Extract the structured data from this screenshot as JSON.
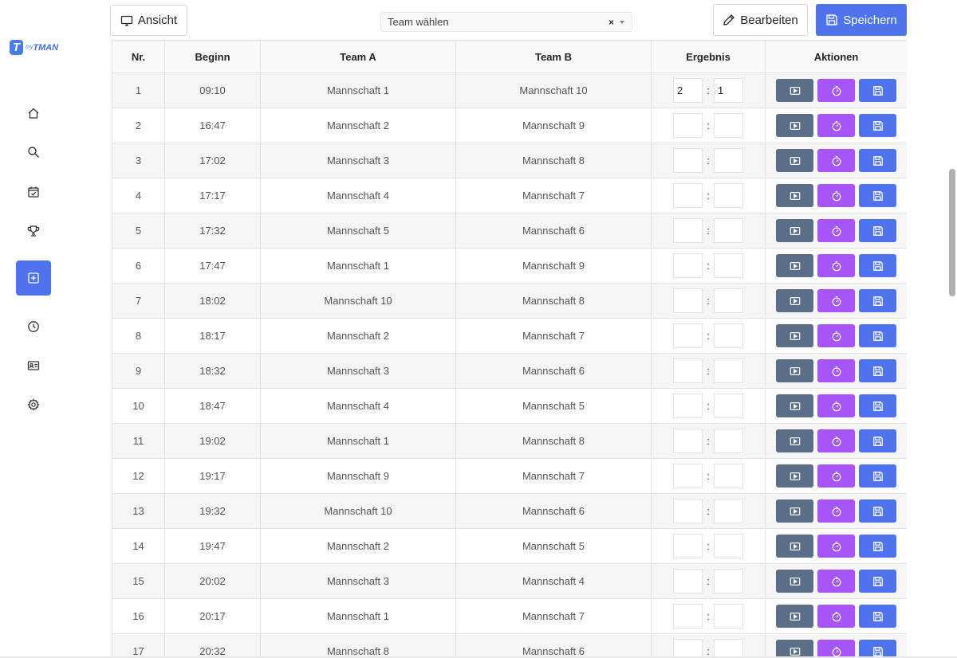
{
  "app": {
    "logo_mark": "T",
    "logo_prefix": "my",
    "logo_name": "TMAN"
  },
  "sidebar": {
    "items": [
      {
        "icon": "home-icon",
        "active": false
      },
      {
        "icon": "search-icon",
        "active": false
      },
      {
        "icon": "calendar-check-icon",
        "active": false
      },
      {
        "icon": "trophy-icon",
        "active": false
      },
      {
        "icon": "plus-square-icon",
        "active": true
      },
      {
        "icon": "clock-icon",
        "active": false
      },
      {
        "icon": "id-card-icon",
        "active": false
      },
      {
        "icon": "gear-icon",
        "active": false
      }
    ]
  },
  "toolbar": {
    "view_label": "Ansicht",
    "team_select_placeholder": "Team wählen",
    "edit_label": "Bearbeiten",
    "save_label": "Speichern"
  },
  "table": {
    "headers": [
      "Nr.",
      "Beginn",
      "Team A",
      "Team B",
      "Ergebnis",
      "Aktionen"
    ],
    "rows": [
      {
        "nr": "1",
        "time": "09:10",
        "team_a": "Mannschaft 1",
        "team_b": "Mannschaft 10",
        "score_a": "2",
        "score_b": "1"
      },
      {
        "nr": "2",
        "time": "16:47",
        "team_a": "Mannschaft 2",
        "team_b": "Mannschaft 9",
        "score_a": "",
        "score_b": ""
      },
      {
        "nr": "3",
        "time": "17:02",
        "team_a": "Mannschaft 3",
        "team_b": "Mannschaft 8",
        "score_a": "",
        "score_b": ""
      },
      {
        "nr": "4",
        "time": "17:17",
        "team_a": "Mannschaft 4",
        "team_b": "Mannschaft 7",
        "score_a": "",
        "score_b": ""
      },
      {
        "nr": "5",
        "time": "17:32",
        "team_a": "Mannschaft 5",
        "team_b": "Mannschaft 6",
        "score_a": "",
        "score_b": ""
      },
      {
        "nr": "6",
        "time": "17:47",
        "team_a": "Mannschaft 1",
        "team_b": "Mannschaft 9",
        "score_a": "",
        "score_b": ""
      },
      {
        "nr": "7",
        "time": "18:02",
        "team_a": "Mannschaft 10",
        "team_b": "Mannschaft 8",
        "score_a": "",
        "score_b": ""
      },
      {
        "nr": "8",
        "time": "18:17",
        "team_a": "Mannschaft 2",
        "team_b": "Mannschaft 7",
        "score_a": "",
        "score_b": ""
      },
      {
        "nr": "9",
        "time": "18:32",
        "team_a": "Mannschaft 3",
        "team_b": "Mannschaft 6",
        "score_a": "",
        "score_b": ""
      },
      {
        "nr": "10",
        "time": "18:47",
        "team_a": "Mannschaft 4",
        "team_b": "Mannschaft 5",
        "score_a": "",
        "score_b": ""
      },
      {
        "nr": "11",
        "time": "19:02",
        "team_a": "Mannschaft 1",
        "team_b": "Mannschaft 8",
        "score_a": "",
        "score_b": ""
      },
      {
        "nr": "12",
        "time": "19:17",
        "team_a": "Mannschaft 9",
        "team_b": "Mannschaft 7",
        "score_a": "",
        "score_b": ""
      },
      {
        "nr": "13",
        "time": "19:32",
        "team_a": "Mannschaft 10",
        "team_b": "Mannschaft 6",
        "score_a": "",
        "score_b": ""
      },
      {
        "nr": "14",
        "time": "19:47",
        "team_a": "Mannschaft 2",
        "team_b": "Mannschaft 5",
        "score_a": "",
        "score_b": ""
      },
      {
        "nr": "15",
        "time": "20:02",
        "team_a": "Mannschaft 3",
        "team_b": "Mannschaft 4",
        "score_a": "",
        "score_b": ""
      },
      {
        "nr": "16",
        "time": "20:17",
        "team_a": "Mannschaft 1",
        "team_b": "Mannschaft 7",
        "score_a": "",
        "score_b": ""
      },
      {
        "nr": "17",
        "time": "20:32",
        "team_a": "Mannschaft 8",
        "team_b": "Mannschaft 6",
        "score_a": "",
        "score_b": ""
      }
    ],
    "score_separator": ":"
  },
  "colors": {
    "primary": "#4f73ee",
    "play_button": "#5a6e87",
    "timer_button": "#a855f7",
    "save_button": "#4f73ee"
  }
}
